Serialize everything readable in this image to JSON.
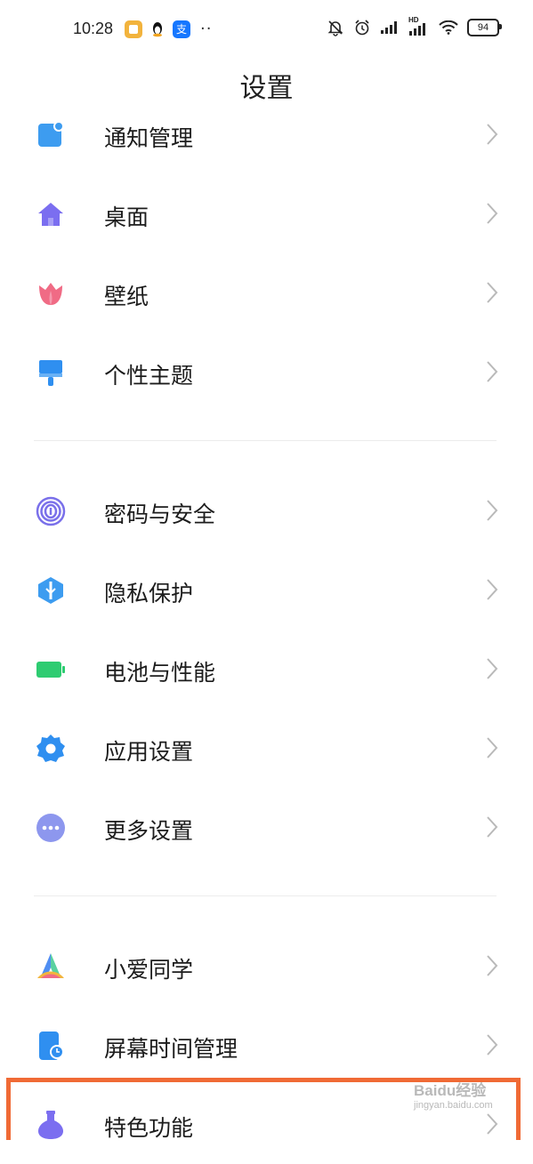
{
  "status": {
    "time": "10:28",
    "more": "··",
    "battery": "94",
    "hd_label": "HD",
    "alipay_char": "支"
  },
  "page": {
    "title": "设置"
  },
  "items": [
    {
      "label": "通知管理",
      "icon": "notification-icon",
      "color": "#3d9cf0"
    },
    {
      "label": "桌面",
      "icon": "home-icon",
      "color": "#7b6ef0"
    },
    {
      "label": "壁纸",
      "icon": "tulip-icon",
      "color": "#f06b85"
    },
    {
      "label": "个性主题",
      "icon": "brush-icon",
      "color": "#2f8ff0"
    },
    {
      "label": "密码与安全",
      "icon": "fingerprint-icon",
      "color": "#7a70ea"
    },
    {
      "label": "隐私保护",
      "icon": "shield-icon",
      "color": "#3d9cf0"
    },
    {
      "label": "电池与性能",
      "icon": "battery-icon",
      "color": "#2ecc71"
    },
    {
      "label": "应用设置",
      "icon": "gear-icon",
      "color": "#2f8ff0"
    },
    {
      "label": "更多设置",
      "icon": "more-icon",
      "color": "#8d97ee"
    },
    {
      "label": "小爱同学",
      "icon": "xiaoai-icon",
      "color": "#5ad1a0"
    },
    {
      "label": "屏幕时间管理",
      "icon": "screen-time-icon",
      "color": "#2f8ff0"
    },
    {
      "label": "特色功能",
      "icon": "flask-icon",
      "color": "#7b6ef0"
    }
  ],
  "watermark": {
    "brand": "Baidu经验",
    "url": "jingyan.baidu.com"
  },
  "highlight_color": "#f06a35"
}
